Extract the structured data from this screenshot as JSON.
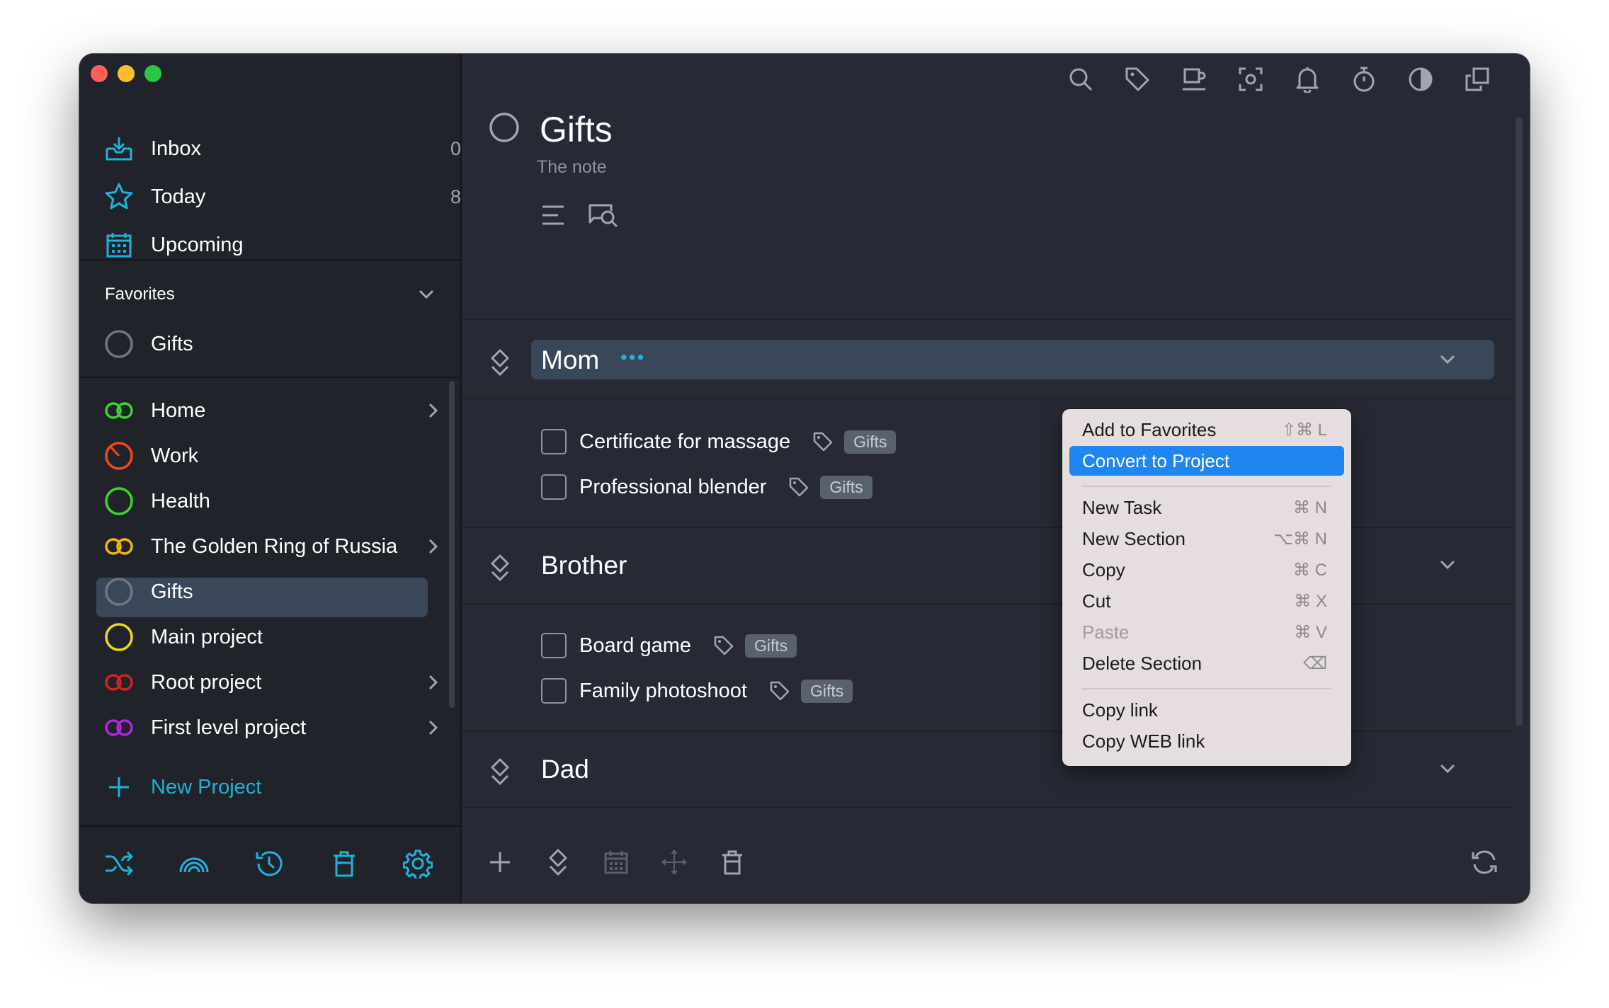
{
  "sidebar": {
    "nav": [
      {
        "label": "Inbox",
        "count": "0",
        "icon": "inbox-icon"
      },
      {
        "label": "Today",
        "count": "8",
        "icon": "star-icon"
      },
      {
        "label": "Upcoming",
        "icon": "calendar-icon"
      }
    ],
    "favorites": {
      "title": "Favorites",
      "items": [
        {
          "label": "Gifts"
        }
      ]
    },
    "projects": [
      {
        "label": "Home",
        "color": "#3cd62c",
        "icon": "double-ring-icon"
      },
      {
        "label": "Work",
        "color": "#ef4a1c",
        "icon": "circle-progress-icon"
      },
      {
        "label": "Health",
        "color": "#3cd62c",
        "icon": "circle-icon"
      },
      {
        "label": "The Golden Ring of Russia",
        "color": "#f2b60c",
        "icon": "double-ring-icon"
      },
      {
        "label": "Gifts",
        "color": "#6f7584",
        "icon": "circle-icon"
      },
      {
        "label": "Main project",
        "color": "#eadb11",
        "icon": "circle-icon"
      },
      {
        "label": "Root project",
        "color": "#d5221f",
        "icon": "double-ring-icon"
      },
      {
        "label": "First level project",
        "color": "#b423e6",
        "icon": "double-ring-icon"
      }
    ],
    "new_project_label": "New Project"
  },
  "main": {
    "title": "Gifts",
    "note": "The note",
    "sections": [
      {
        "title": "Mom",
        "more": "•••",
        "tasks": [
          {
            "label": "Certificate for massage",
            "tag": "Gifts"
          },
          {
            "label": "Professional blender",
            "tag": "Gifts"
          }
        ]
      },
      {
        "title": "Brother",
        "tasks": [
          {
            "label": "Board game",
            "tag": "Gifts"
          },
          {
            "label": "Family photoshoot",
            "tag": "Gifts"
          }
        ]
      },
      {
        "title": "Dad",
        "tasks": []
      }
    ]
  },
  "context_menu": {
    "items": [
      {
        "label": "Add to Favorites",
        "shortcut": "⇧⌘ L"
      },
      {
        "label": "Convert to Project",
        "shortcut": ""
      },
      {
        "label": "New Task",
        "shortcut": "⌘ N"
      },
      {
        "label": "New Section",
        "shortcut": "⌥⌘ N"
      },
      {
        "label": "Copy",
        "shortcut": "⌘ C"
      },
      {
        "label": "Cut",
        "shortcut": "⌘ X"
      },
      {
        "label": "Paste",
        "shortcut": "⌘ V"
      },
      {
        "label": "Delete Section",
        "shortcut": "⌫"
      },
      {
        "label": "Copy link",
        "shortcut": ""
      },
      {
        "label": "Copy WEB link",
        "shortcut": ""
      }
    ]
  },
  "colors": {
    "accent": "#1fb2d8",
    "highlight": "#1f85ef",
    "selection": "#3a4759"
  }
}
